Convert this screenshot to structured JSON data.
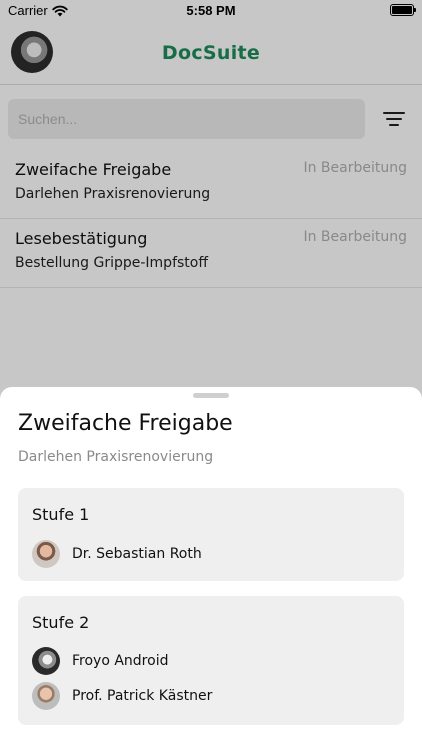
{
  "status_bar": {
    "carrier": "Carrier",
    "time": "5:58 PM"
  },
  "header": {
    "title": "DocSuite"
  },
  "search": {
    "placeholder": "Suchen..."
  },
  "list": [
    {
      "title": "Zweifache Freigabe",
      "subtitle": "Darlehen Praxisrenovierung",
      "status": "In Bearbeitung"
    },
    {
      "title": "Lesebestätigung",
      "subtitle": "Bestellung Grippe-Impfstoff",
      "status": "In Bearbeitung"
    }
  ],
  "sheet": {
    "title": "Zweifache Freigabe",
    "subtitle": "Darlehen Praxisrenovierung",
    "stages": [
      {
        "title": "Stufe 1",
        "people": [
          {
            "name": "Dr. Sebastian Roth"
          }
        ]
      },
      {
        "title": "Stufe 2",
        "people": [
          {
            "name": "Froyo Android"
          },
          {
            "name": "Prof. Patrick Kästner"
          }
        ]
      }
    ]
  },
  "colors": {
    "brand": "#1f8c5a",
    "status_text": "#b0b0b0",
    "card_bg": "#efefef"
  }
}
